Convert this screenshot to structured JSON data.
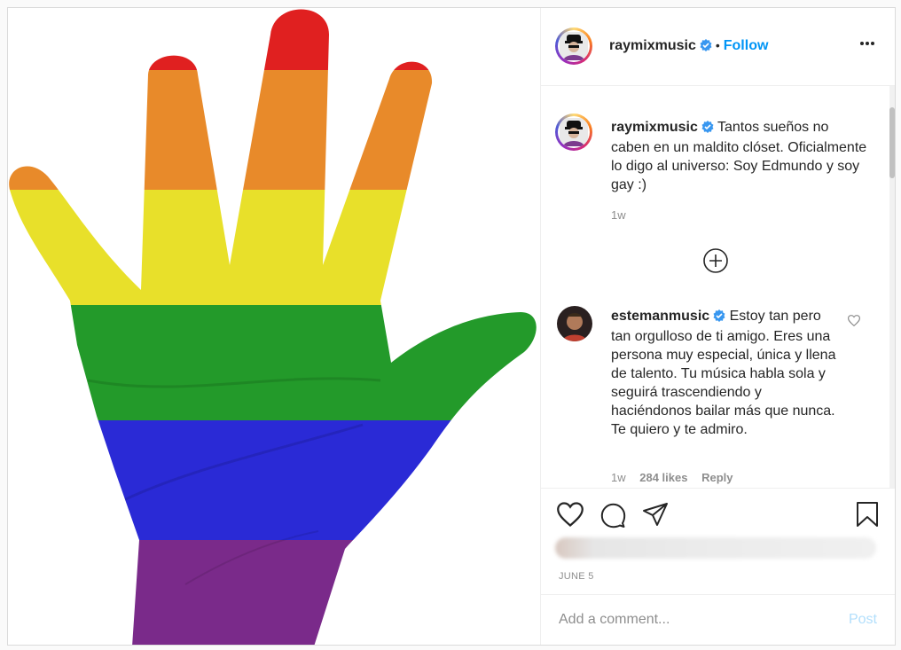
{
  "post": {
    "username": "raymixmusic",
    "separator": "•",
    "follow_label": "Follow",
    "date": "JUNE 5"
  },
  "caption": {
    "username": "raymixmusic",
    "text": "Tantos sueños no caben en un maldito clóset. Oficialmente lo digo al universo: Soy Edmundo y soy gay :)",
    "time": "1w"
  },
  "comment": {
    "username": "estemanmusic",
    "text": "Estoy tan pero tan orgulloso de ti amigo. Eres una persona muy especial, única y llena de talento. Tu música habla sola y seguirá trascendiendo y haciéndonos bailar más que nunca. Te quiero y te admiro.",
    "time": "1w",
    "likes": "284 likes",
    "reply_label": "Reply"
  },
  "add_comment": {
    "placeholder": "Add a comment...",
    "post_label": "Post"
  },
  "icons": {
    "verified": "verified-badge-icon",
    "more": "more-options-icon",
    "load_more": "plus-circle-icon",
    "like": "heart-icon",
    "comment": "comment-bubble-icon",
    "share": "paper-plane-icon",
    "save": "bookmark-icon"
  },
  "colors": {
    "accent": "#0095f6",
    "verified": "#3897f0",
    "post_disabled": "#b2dffc",
    "flag_red": "#e02020",
    "flag_orange": "#e88a2a",
    "flag_yellow": "#e8e02a",
    "flag_green": "#239a2a",
    "flag_blue": "#2a2ad6",
    "flag_purple": "#7a2a8a"
  }
}
